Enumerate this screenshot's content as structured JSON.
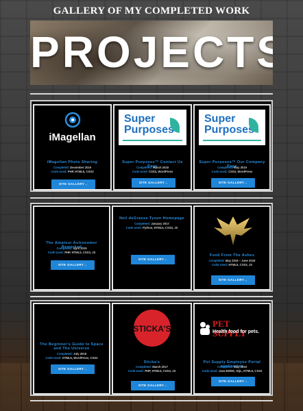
{
  "page": {
    "title": "GALLERY OF MY COMPLETED WORK",
    "hero_word": "PROJECTS"
  },
  "labels": {
    "completed": "Completed:",
    "code_used": "Code Used:",
    "button": "SITE GALLERY→"
  },
  "cards": [
    {
      "title": "iMagellan Photo Sharing",
      "completed": "December 2019",
      "code": "PHP, HTML5, CSS3",
      "logo_text": "iMagellan"
    },
    {
      "title": "Super Purposes™ Contact Us Page",
      "completed": "March 2019",
      "code": "CSS3, WordPress",
      "logo_text_1": "Super",
      "logo_text_2": "Purposes"
    },
    {
      "title": "Super Purposes™ Our Company Page",
      "completed": "May 2019",
      "code": "CSS3, WordPress",
      "logo_text_1": "Super",
      "logo_text_2": "Purposes"
    },
    {
      "title": "The Amateur Astronomer Reworked",
      "completed": "April 2019",
      "code": "PHP, HTML5, CSS3, JS"
    },
    {
      "title": "Neil deGrasse Tyson Homepage",
      "completed": "January 2017",
      "code": "Python, HTML5, CSS3, JS"
    },
    {
      "title": "Food From The Ashes",
      "completed": "May 2016",
      "completed_to": "June 2019",
      "code": "HTML5, CSS3, JS"
    },
    {
      "title": "The Beginner's Guide to Space and The Universe",
      "completed": "July 2018",
      "code": "HTML5, WordPress, CSS3"
    },
    {
      "title": "Sticka's",
      "completed": "March 2017",
      "code": "PHP, HTML5, CSS3, JS",
      "logo_text": "STICKA'S"
    },
    {
      "title": "Pet Supply Employee Portal application",
      "completed": "May 2019",
      "code": "Java EE/EE, SQL, HTML5, CSS3",
      "logo_text_1": "PET SUPPLY",
      "logo_text_2": "Health food for pets."
    }
  ],
  "colors": {
    "accent": "#2a8fe0",
    "button": "#1f86d8",
    "supply_red": "#d4201f"
  }
}
